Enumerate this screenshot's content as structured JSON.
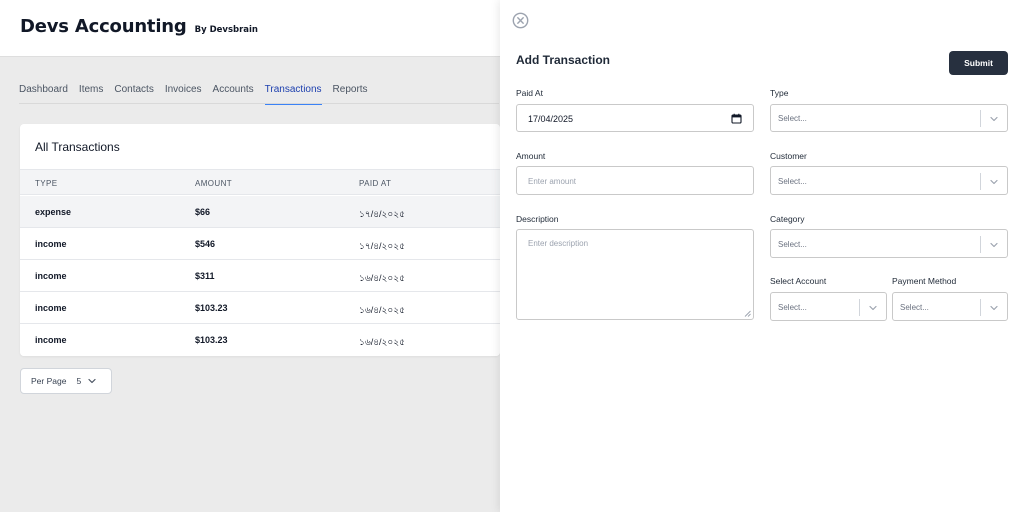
{
  "app": {
    "title": "Devs Accounting",
    "subtitle": "By Devsbrain"
  },
  "nav": {
    "tabs": [
      {
        "label": "Dashboard"
      },
      {
        "label": "Items"
      },
      {
        "label": "Contacts"
      },
      {
        "label": "Invoices"
      },
      {
        "label": "Accounts"
      },
      {
        "label": "Transactions",
        "active": true
      },
      {
        "label": "Reports"
      }
    ]
  },
  "transactions": {
    "title": "All Transactions",
    "columns": [
      "TYPE",
      "AMOUNT",
      "PAID AT"
    ],
    "rows": [
      {
        "type": "expense",
        "amount": "$66",
        "paid_at": "১৭/৪/২০২৫"
      },
      {
        "type": "income",
        "amount": "$546",
        "paid_at": "১৭/৪/২০২৫"
      },
      {
        "type": "income",
        "amount": "$311",
        "paid_at": "১৬/৪/২০২৫"
      },
      {
        "type": "income",
        "amount": "$103.23",
        "paid_at": "১৬/৪/২০২৫"
      },
      {
        "type": "income",
        "amount": "$103.23",
        "paid_at": "১৬/৪/২০২৫"
      }
    ]
  },
  "pagination": {
    "per_page_label": "Per Page",
    "per_page_value": "5"
  },
  "drawer": {
    "title": "Add Transaction",
    "submit_label": "Submit",
    "fields": {
      "paid_at": {
        "label": "Paid At",
        "value": "17/04/2025"
      },
      "type": {
        "label": "Type",
        "placeholder": "Select..."
      },
      "amount": {
        "label": "Amount",
        "placeholder": "Enter amount"
      },
      "customer": {
        "label": "Customer",
        "placeholder": "Select..."
      },
      "description": {
        "label": "Description",
        "placeholder": "Enter description"
      },
      "category": {
        "label": "Category",
        "placeholder": "Select..."
      },
      "account": {
        "label": "Select Account",
        "placeholder": "Select..."
      },
      "payment_method": {
        "label": "Payment Method",
        "placeholder": "Select..."
      }
    }
  },
  "colors": {
    "accent": "#3b82f6",
    "active_tab_text": "#1e40af",
    "submit_bg": "#27303f",
    "page_bg": "#ebebeb"
  },
  "icons": [
    "close-circle-icon",
    "calendar-icon",
    "chevron-down-icon"
  ]
}
